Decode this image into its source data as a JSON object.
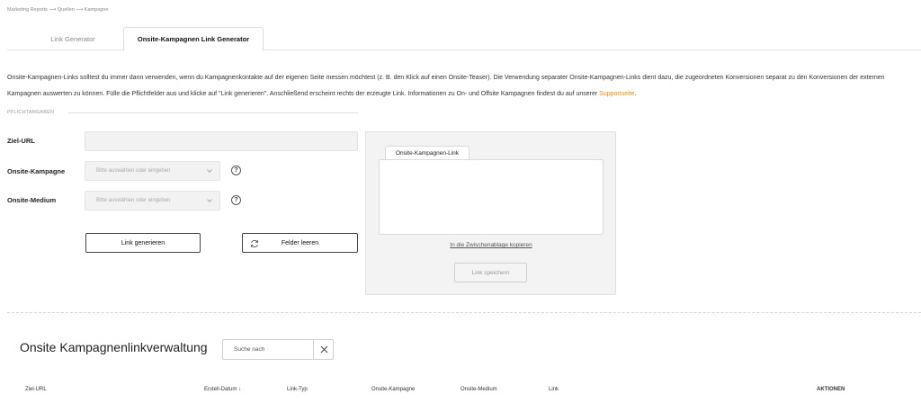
{
  "breadcrumb": "Marketing Reports ⟶ Quellen ⟶ Kampagne",
  "tabs": [
    {
      "label": "Link Generator",
      "active": false
    },
    {
      "label": "Onsite-Kampagnen Link Generator",
      "active": true
    }
  ],
  "intro": {
    "text": "Onsite-Kampagnen-Links solltest du immer dann verwenden, wenn du Kampagnenkontakte auf der eigenen Seite messen möchtest (z. B. den Klick auf einen Onsite-Teaser). Die Verwendung separater Onsite-Kampagnen-Links dient dazu, die zugeordneten Konversionen separat zu den Konversionen der externen Kampagnen auswerten zu können. Fülle die Pflichtfelder aus und klicke auf \"Link generieren\". Anschließend erscheint rechts der erzeugte Link. Informationen zu On- und Offsite Kampagnen findest du auf unserer ",
    "link_text": "Supportseite",
    "suffix": "."
  },
  "form": {
    "required_label": "PFLICHTANGABEN",
    "target_url_label": "Ziel-URL",
    "target_url_value": "",
    "campaign_label": "Onsite-Kampagne",
    "campaign_placeholder": "Bitte auswählen oder eingeben",
    "medium_label": "Onsite-Medium",
    "medium_placeholder": "Bitte auswählen oder eingeben",
    "help_glyph": "?",
    "generate_button": "Link generieren",
    "clear_button": "Felder leeren"
  },
  "output": {
    "tab_label": "Onsite-Kampagnen-Link",
    "link_value": "",
    "copy_link": "In die Zwischenablage kopieren",
    "save_button": "Link speichern"
  },
  "management": {
    "title": "Onsite Kampagnenlinkverwaltung",
    "search_placeholder": "Suche nach",
    "clear_glyph": "✕"
  },
  "table": {
    "headers": [
      "Ziel-URL",
      "Erstell-Datum",
      "Link-Typ",
      "Onsite-Kampagne",
      "Onsite-Medium",
      "Link",
      "AKTIONEN"
    ],
    "sort_glyph": "↓"
  },
  "colors": {
    "accent": "#f08a24",
    "panel_bg": "#f3f3f3",
    "input_bg": "#f2f2f2"
  }
}
